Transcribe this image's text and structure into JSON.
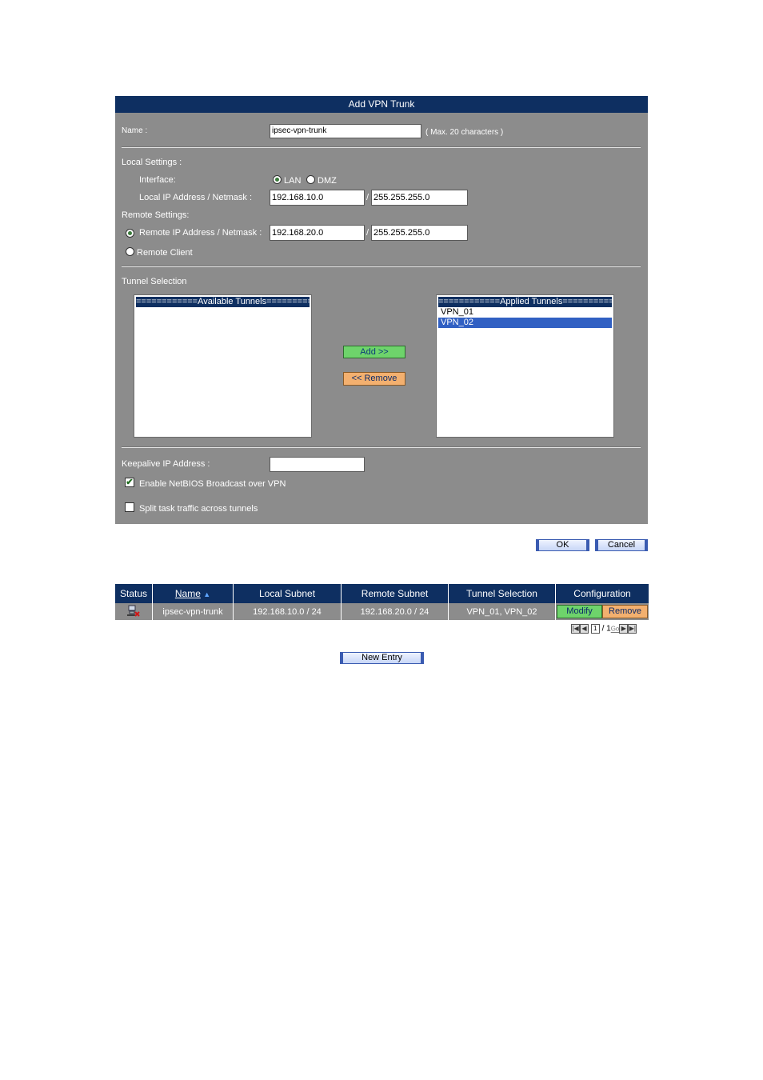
{
  "form": {
    "title": "Add VPN Trunk",
    "name_label": "Name :",
    "name_value": "ipsec-vpn-trunk",
    "name_hint": "( Max. 20 characters )",
    "local_settings_label": "Local Settings :",
    "interface_label": "Interface:",
    "interface_options": [
      "LAN",
      "DMZ"
    ],
    "interface_selected": "LAN",
    "local_ip_label": "Local IP Address / Netmask :",
    "local_ip_value": "192.168.10.0",
    "local_netmask_value": "255.255.255.0",
    "remote_settings_label": "Remote Settings:",
    "remote_ip_label": "Remote IP Address / Netmask :",
    "remote_ip_value": "192.168.20.0",
    "remote_netmask_value": "255.255.255.0",
    "remote_client_label": "Remote Client",
    "slash": "/",
    "tunnel_selection_label": "Tunnel Selection",
    "available_header": "============Available Tunnels============",
    "applied_header": "============Applied Tunnels============",
    "applied_items": [
      "VPN_01",
      "VPN_02"
    ],
    "applied_selected": "VPN_02",
    "add_button": "Add >>",
    "remove_button": "<< Remove",
    "keepalive_label": "Keepalive IP Address :",
    "keepalive_value": "",
    "netbios_label": "Enable NetBIOS Broadcast over VPN",
    "netbios_checked": true,
    "split_label": "Split task traffic across tunnels",
    "split_checked": false
  },
  "actions": {
    "ok": "OK",
    "cancel": "Cancel"
  },
  "table": {
    "headers": [
      "Status",
      "Name",
      "Local Subnet",
      "Remote Subnet",
      "Tunnel Selection",
      "Configuration"
    ],
    "rows": [
      {
        "name": "ipsec-vpn-trunk",
        "local": "192.168.10.0 / 24",
        "remote": "192.168.20.0 / 24",
        "tunnels": "VPN_01, VPN_02",
        "modify": "Modify",
        "remove": "Remove"
      }
    ]
  },
  "pager": {
    "page": "1",
    "separator": "/",
    "total": "1",
    "go": "Go"
  },
  "new_entry": "New Entry",
  "colors": {
    "header": "#0e2f61",
    "panel": "#8c8c8c",
    "selection": "#3160c3"
  }
}
